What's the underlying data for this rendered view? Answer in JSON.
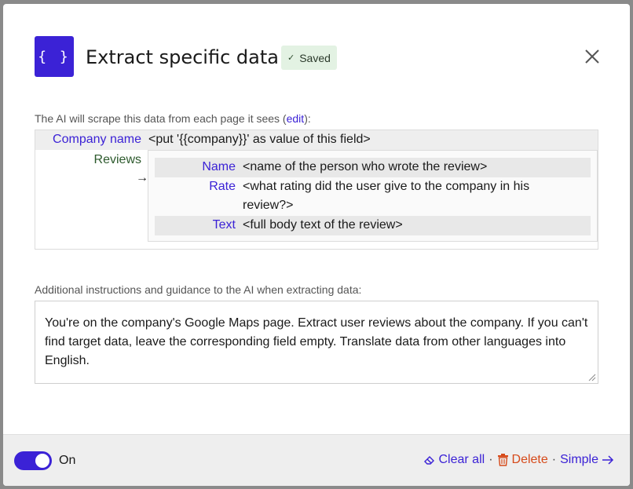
{
  "header": {
    "logo_text": "{ }",
    "title": "Extract specific data",
    "saved_badge": "Saved"
  },
  "intro": {
    "text_before": "The AI will scrape this data from each page it sees (",
    "edit_link": "edit",
    "text_after": "):"
  },
  "schema": {
    "company": {
      "label": "Company name",
      "value": "<put '{{company}}' as value of this field>"
    },
    "reviews": {
      "label": "Reviews",
      "arrow": "→",
      "fields": [
        {
          "label": "Name",
          "value": "<name of the person who wrote the review>"
        },
        {
          "label": "Rate",
          "value": "<what rating did the user give to the company in his review?>"
        },
        {
          "label": "Text",
          "value": "<full body text of the review>"
        }
      ]
    }
  },
  "additional": {
    "label": "Additional instructions and guidance to the AI when extracting data:",
    "value": "You're on the company's Google Maps page. Extract user reviews about the company. If you can't find target data, leave the corresponding field empty. Translate data from other languages into English."
  },
  "footer": {
    "toggle_label": "On",
    "toggle_on": true,
    "clear_label": "Clear all",
    "delete_label": "Delete",
    "simple_label": "Simple",
    "separator": "·"
  },
  "colors": {
    "accent": "#3b22d6",
    "danger": "#d64a1a",
    "saved_bg": "#e3f2e3"
  }
}
